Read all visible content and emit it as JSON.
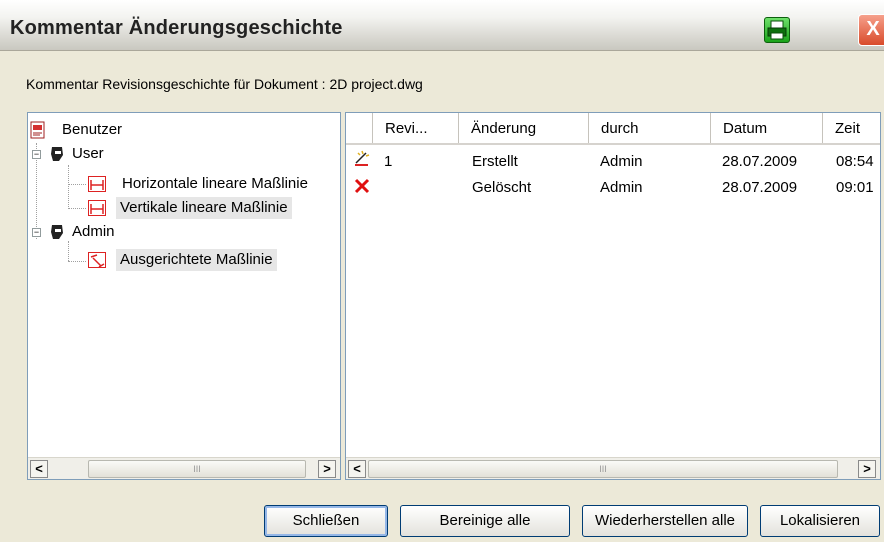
{
  "window": {
    "title": "Kommentar Änderungsgeschichte",
    "print_icon": "printer-icon",
    "close_icon": "close-icon",
    "close_glyph": "X"
  },
  "subtitle": "Kommentar Revisionsgeschichte für Dokument : 2D project.dwg",
  "tree": {
    "root": {
      "label": "Benutzer",
      "icon": "document-users-icon"
    },
    "groups": [
      {
        "label": "User",
        "icon": "user-head-icon",
        "expander": "−",
        "items": [
          {
            "label": "Horizontale lineare Maßlinie",
            "icon": "horizontal-dimension-icon"
          },
          {
            "label": "Vertikale lineare Maßlinie",
            "icon": "vertical-dimension-icon"
          }
        ]
      },
      {
        "label": "Admin",
        "icon": "user-head-icon",
        "expander": "−",
        "items": [
          {
            "label": "Ausgerichtete Maßlinie",
            "icon": "aligned-dimension-icon"
          }
        ]
      }
    ]
  },
  "list": {
    "columns": [
      "Revi...",
      "Änderung",
      "durch",
      "Datum",
      "Zeit"
    ],
    "rows": [
      {
        "icon": "created-icon",
        "revision": "1",
        "change": "Erstellt",
        "by": "Admin",
        "date": "28.07.2009",
        "time": "08:54"
      },
      {
        "icon": "deleted-icon",
        "revision": "",
        "change": "Gelöscht",
        "by": "Admin",
        "date": "28.07.2009",
        "time": "09:01"
      }
    ]
  },
  "scrollbars": {
    "left_arrow": "<",
    "right_arrow": ">",
    "thumb_grip": "III"
  },
  "buttons": {
    "close": "Schließen",
    "clean_all": "Bereinige alle",
    "restore_all": "Wiederherstellen alle",
    "locate": "Lokalisieren"
  },
  "colors": {
    "dialog_bg": "#ECE9D8",
    "accent_red": "#DD2222",
    "print_green": "#1AA31A"
  }
}
